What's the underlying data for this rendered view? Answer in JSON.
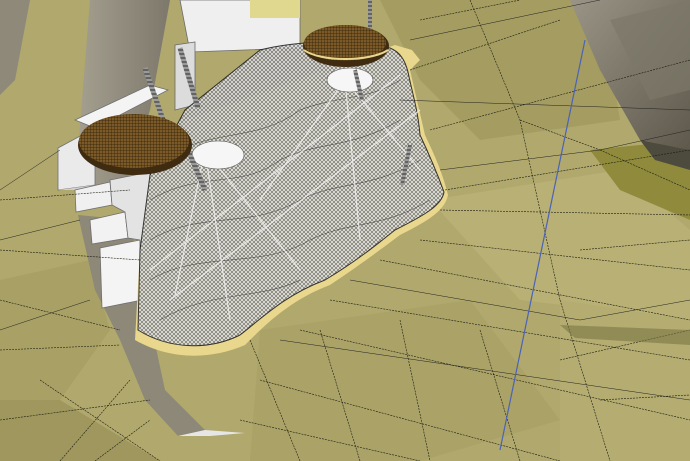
{
  "window": {
    "title": ""
  },
  "scene": {
    "description_hidden": "",
    "colors": {
      "terrain": "#b1a96d",
      "terrain_dark": "#8e8752",
      "terrain_shadow": "#6f6a43",
      "rock": "#8c8676",
      "rock_dark": "#5c574b",
      "pad_white": "#f4f4f4",
      "pad_shade": "#d9d9d9",
      "deck": "#7a5a26",
      "deck_dark": "#3d2a10",
      "mesh": "#bfbfbf",
      "mesh_line": "#3b3b3b",
      "sand_edge": "#e6d58a",
      "axis_blue": "#4a63b8",
      "edge_line": "#1b1b12"
    },
    "icons": [
      "deck-disc-icon",
      "steel-pile-icon",
      "axis-line-icon"
    ]
  }
}
